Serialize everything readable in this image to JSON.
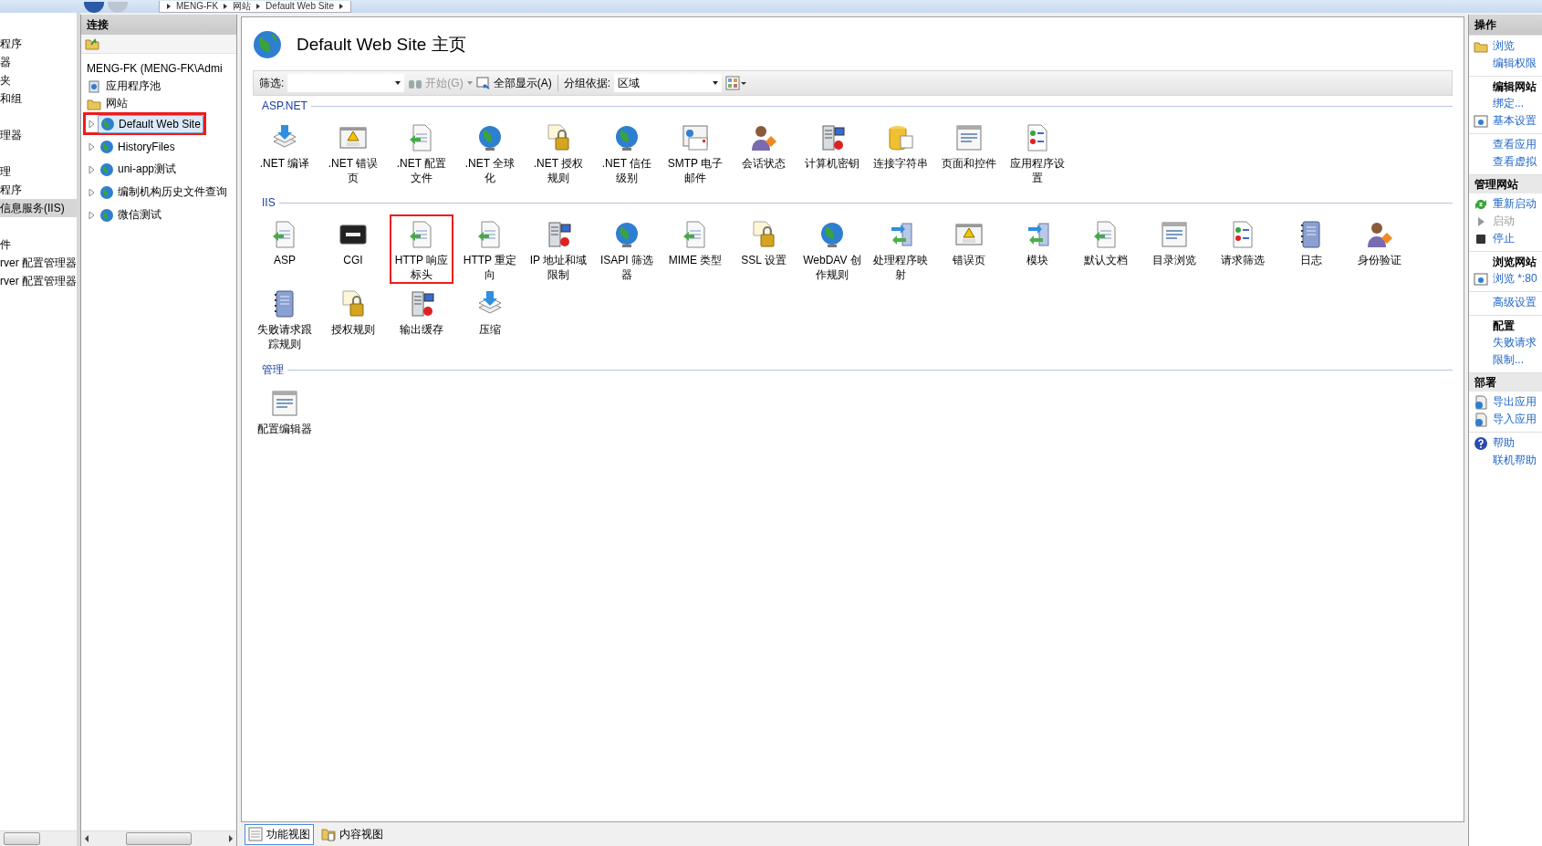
{
  "breadcrumb": [
    "MENG-FK",
    "网站",
    "Default Web Site"
  ],
  "left_strip": {
    "groups": [
      {
        "items": [
          {
            "label": "程序",
            "selected": false
          },
          {
            "label": "器",
            "selected": false
          },
          {
            "label": "夹",
            "selected": false
          },
          {
            "label": "和组",
            "selected": false
          }
        ]
      },
      {
        "items": [
          {
            "label": "理器",
            "selected": false
          }
        ]
      },
      {
        "items": [
          {
            "label": "理",
            "selected": false
          },
          {
            "label": "程序",
            "selected": false
          },
          {
            "label": "信息服务(IIS)",
            "selected": true
          }
        ]
      },
      {
        "items": [
          {
            "label": "件",
            "selected": false
          },
          {
            "label": "rver 配置管理器",
            "selected": false
          },
          {
            "label": "rver 配置管理器",
            "selected": false
          }
        ]
      }
    ]
  },
  "connections": {
    "title": "连接",
    "tree": [
      {
        "label": "MENG-FK (MENG-FK\\Admi",
        "selected": false,
        "children": [
          {
            "label": "应用程序池",
            "kind": "pool",
            "selected": false
          },
          {
            "label": "网站",
            "kind": "folder",
            "selected": false,
            "children": [
              {
                "label": "Default Web Site",
                "kind": "site",
                "selected": true,
                "highlighted": true,
                "expanded": false
              },
              {
                "label": "HistoryFiles",
                "kind": "site",
                "selected": false,
                "highlighted": false,
                "expanded": false
              },
              {
                "label": "uni-app测试",
                "kind": "site",
                "selected": false,
                "highlighted": false,
                "expanded": false
              },
              {
                "label": "编制机构历史文件查询",
                "kind": "site",
                "selected": false,
                "highlighted": false,
                "expanded": false
              },
              {
                "label": "微信测试",
                "kind": "site",
                "selected": false,
                "highlighted": false,
                "expanded": false
              }
            ]
          }
        ]
      }
    ]
  },
  "page": {
    "title": "Default Web Site 主页",
    "filter": {
      "label": "筛选:",
      "go": "开始(G)",
      "go_disabled": true,
      "show_all": "全部显示(A)",
      "group_by_label": "分组依据:",
      "group_by_value": "区域"
    },
    "sections": [
      {
        "title": "ASP.NET",
        "features": [
          {
            "label": ".NET 编译",
            "highlighted": false
          },
          {
            "label": ".NET 错误页",
            "highlighted": false
          },
          {
            "label": ".NET 配置文件",
            "highlighted": false
          },
          {
            "label": ".NET 全球化",
            "highlighted": false
          },
          {
            "label": ".NET 授权规则",
            "highlighted": false
          },
          {
            "label": ".NET 信任级别",
            "highlighted": false
          },
          {
            "label": "SMTP 电子邮件",
            "highlighted": false
          },
          {
            "label": "会话状态",
            "highlighted": false
          },
          {
            "label": "计算机密钥",
            "highlighted": false
          },
          {
            "label": "连接字符串",
            "highlighted": false
          },
          {
            "label": "页面和控件",
            "highlighted": false
          },
          {
            "label": "应用程序设置",
            "highlighted": false
          }
        ]
      },
      {
        "title": "IIS",
        "features": [
          {
            "label": "ASP",
            "highlighted": false
          },
          {
            "label": "CGI",
            "highlighted": false
          },
          {
            "label": "HTTP 响应标头",
            "highlighted": true
          },
          {
            "label": "HTTP 重定向",
            "highlighted": false
          },
          {
            "label": "IP 地址和域限制",
            "highlighted": false
          },
          {
            "label": "ISAPI 筛选器",
            "highlighted": false
          },
          {
            "label": "MIME 类型",
            "highlighted": false
          },
          {
            "label": "SSL 设置",
            "highlighted": false
          },
          {
            "label": "WebDAV 创作规则",
            "highlighted": false
          },
          {
            "label": "处理程序映射",
            "highlighted": false
          },
          {
            "label": "错误页",
            "highlighted": false
          },
          {
            "label": "模块",
            "highlighted": false
          },
          {
            "label": "默认文档",
            "highlighted": false
          },
          {
            "label": "目录浏览",
            "highlighted": false
          },
          {
            "label": "请求筛选",
            "highlighted": false
          },
          {
            "label": "日志",
            "highlighted": false
          },
          {
            "label": "身份验证",
            "highlighted": false
          },
          {
            "label": "失败请求跟踪规则",
            "highlighted": false
          },
          {
            "label": "授权规则",
            "highlighted": false
          },
          {
            "label": "输出缓存",
            "highlighted": false
          },
          {
            "label": "压缩",
            "highlighted": false
          }
        ]
      },
      {
        "title": "管理",
        "features": [
          {
            "label": "配置编辑器",
            "highlighted": false
          }
        ]
      }
    ]
  },
  "view_tabs": [
    {
      "label": "功能视图",
      "selected": true
    },
    {
      "label": "内容视图",
      "selected": false
    }
  ],
  "actions": {
    "title": "操作",
    "groups": [
      {
        "kind": "plain",
        "items": [
          {
            "label": "浏览",
            "disabled": false
          },
          {
            "label": "编辑权限",
            "disabled": false
          }
        ]
      },
      {
        "kind": "subheader",
        "title": "编辑网站",
        "items": [
          {
            "label": "绑定...",
            "disabled": false
          },
          {
            "label": "基本设置",
            "disabled": false
          }
        ]
      },
      {
        "kind": "plain",
        "items": [
          {
            "label": "查看应用",
            "disabled": false
          },
          {
            "label": "查看虚拟",
            "disabled": false
          }
        ]
      },
      {
        "kind": "header",
        "title": "管理网站",
        "items": [
          {
            "label": "重新启动",
            "disabled": false
          },
          {
            "label": "启动",
            "disabled": true
          },
          {
            "label": "停止",
            "disabled": false
          }
        ]
      },
      {
        "kind": "subheader",
        "title": "浏览网站",
        "items": [
          {
            "label": "浏览 *:80",
            "disabled": false
          }
        ]
      },
      {
        "kind": "plain",
        "items": [
          {
            "label": "高级设置",
            "disabled": false
          }
        ]
      },
      {
        "kind": "subheader",
        "title": "配置",
        "items": [
          {
            "label": "失败请求",
            "disabled": false
          },
          {
            "label": "限制...",
            "disabled": false
          }
        ]
      },
      {
        "kind": "header",
        "title": "部署",
        "items": [
          {
            "label": "导出应用",
            "disabled": false
          },
          {
            "label": "导入应用",
            "disabled": false
          }
        ]
      },
      {
        "kind": "plain",
        "items": [
          {
            "label": "帮助",
            "disabled": false
          },
          {
            "label": "联机帮助",
            "disabled": false
          }
        ]
      }
    ]
  }
}
